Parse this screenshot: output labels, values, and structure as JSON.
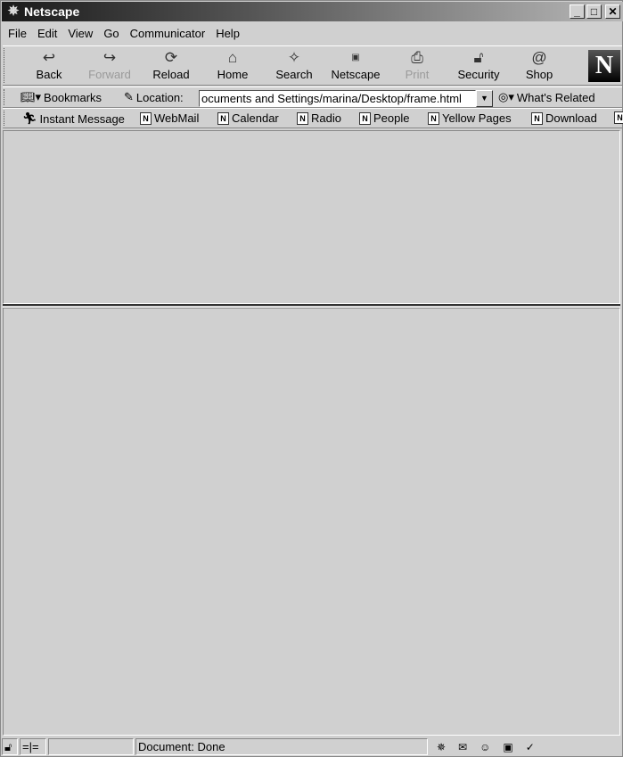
{
  "window": {
    "title": "Netscape",
    "minimize": "_",
    "maximize": "□",
    "close": "✕"
  },
  "menu": [
    "File",
    "Edit",
    "View",
    "Go",
    "Communicator",
    "Help"
  ],
  "navigation": [
    {
      "label": "Back",
      "icon": "back-arrow-icon",
      "enabled": true
    },
    {
      "label": "Forward",
      "icon": "forward-arrow-icon",
      "enabled": false
    },
    {
      "label": "Reload",
      "icon": "reload-icon",
      "enabled": true
    },
    {
      "label": "Home",
      "icon": "home-icon",
      "enabled": true
    },
    {
      "label": "Search",
      "icon": "search-flashlight-icon",
      "enabled": true
    },
    {
      "label": "Netscape",
      "icon": "my-netscape-icon",
      "enabled": true
    },
    {
      "label": "Print",
      "icon": "printer-icon",
      "enabled": false
    },
    {
      "label": "Security",
      "icon": "padlock-icon",
      "enabled": true
    },
    {
      "label": "Shop",
      "icon": "shopping-bag-icon",
      "enabled": true
    }
  ],
  "logo": "N",
  "location": {
    "bookmarks": "Bookmarks",
    "label": "Location:",
    "url": "ocuments and Settings/marina/Desktop/frame.html",
    "whats_related": "What's Related"
  },
  "personal": [
    "Instant Message",
    "WebMail",
    "Calendar",
    "Radio",
    "People",
    "Yellow Pages",
    "Download"
  ],
  "status": {
    "text": "Document: Done"
  }
}
